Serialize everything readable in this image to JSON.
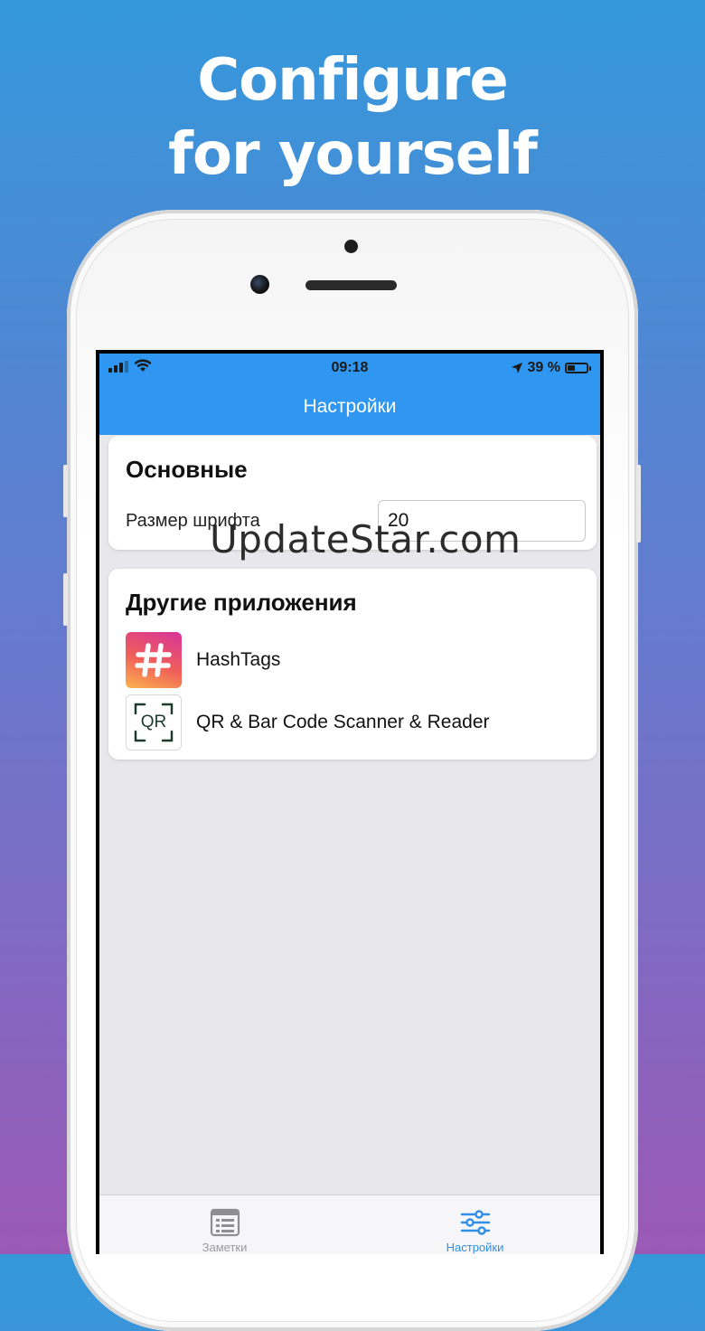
{
  "headline": {
    "line1": "Configure",
    "line2": "for yourself"
  },
  "statusbar": {
    "time": "09:18",
    "battery": "39 %",
    "battery_level": 0.39
  },
  "navbar": {
    "title": "Настройки"
  },
  "general": {
    "title": "Основные",
    "font_size_label": "Размер шрифта",
    "font_size_value": "20"
  },
  "other_apps": {
    "title": "Другие приложения",
    "apps": [
      {
        "name": "HashTags",
        "icon": "hashtag-icon"
      },
      {
        "name": "QR & Bar Code Scanner & Reader",
        "icon": "qr-icon",
        "icon_text": "QR"
      }
    ]
  },
  "watermark": "UpdateStar.com",
  "tabbar": {
    "tabs": [
      {
        "label": "Заметки",
        "icon": "notes-icon",
        "active": false
      },
      {
        "label": "Настройки",
        "icon": "sliders-icon",
        "active": true
      }
    ]
  },
  "colors": {
    "accent": "#2f97f1",
    "tab_active": "#2f8fe6",
    "tab_inactive": "#9a9a9a"
  }
}
